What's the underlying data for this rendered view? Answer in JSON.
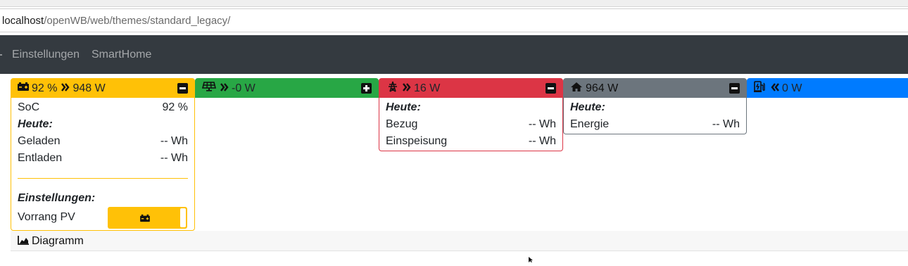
{
  "browser": {
    "url_host": "localhost",
    "url_path": "/openWB/web/themes/standard_legacy/"
  },
  "navbar": {
    "items": [
      {
        "label": "Einstellungen"
      },
      {
        "label": "SmartHome"
      }
    ]
  },
  "battery": {
    "header_soc": "92 %",
    "header_power": "948 W",
    "soc_label": "SoC",
    "soc_value": "92 %",
    "today_heading": "Heute:",
    "charged_label": "Geladen",
    "charged_value": "-- Wh",
    "discharged_label": "Entladen",
    "discharged_value": "-- Wh",
    "settings_heading": "Einstellungen:",
    "pv_priority_label": "Vorrang PV",
    "color": "#ffc107"
  },
  "pv": {
    "header_power": "-0 W",
    "color": "#28a745"
  },
  "grid": {
    "header_power": "16 W",
    "today_heading": "Heute:",
    "import_label": "Bezug",
    "import_value": "-- Wh",
    "export_label": "Einspeisung",
    "export_value": "-- Wh",
    "color": "#dc3545"
  },
  "house": {
    "header_power": "964 W",
    "today_heading": "Heute:",
    "energy_label": "Energie",
    "energy_value": "-- Wh",
    "color": "#6c757d"
  },
  "chargepoint": {
    "header_power": "0 W",
    "color": "#007bff"
  },
  "diagram": {
    "label": "Diagramm"
  },
  "icons": [
    "car-battery-icon",
    "angle-double-right-icon",
    "minus-square-icon",
    "solar-panel-icon",
    "plus-square-icon",
    "power-tower-icon",
    "home-icon",
    "charging-station-icon",
    "angle-double-left-icon",
    "chart-area-icon"
  ]
}
